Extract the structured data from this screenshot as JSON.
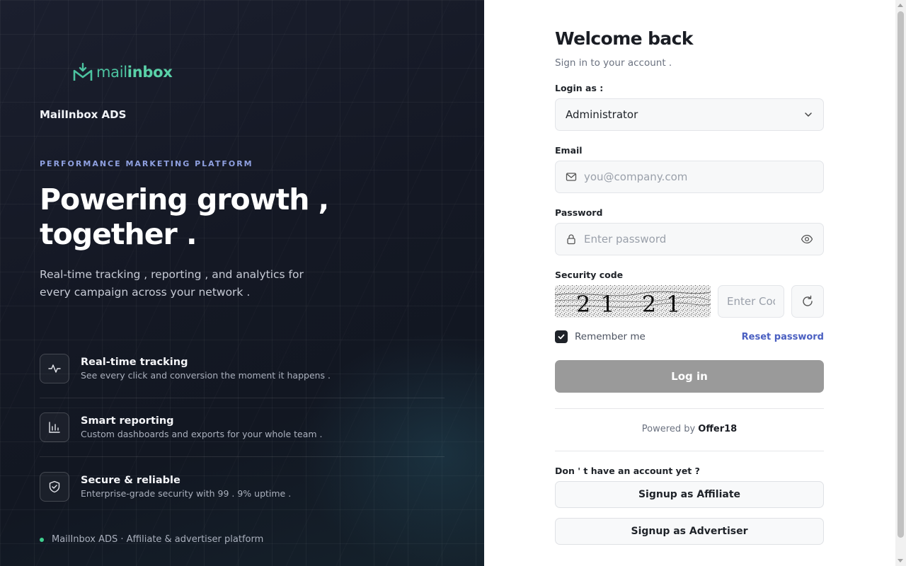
{
  "left": {
    "logo_part1": "mail",
    "logo_part2": "inbox",
    "brand": "MailInbox ADS",
    "eyebrow": "PERFORMANCE MARKETING PLATFORM",
    "headline_line1": "Powering growth ,",
    "headline_line2": "together .",
    "subtitle": "Real-time tracking , reporting , and analytics for every campaign across your network .",
    "features": [
      {
        "icon": "activity-icon",
        "title": "Real-time tracking",
        "desc": "See every click and conversion the moment it happens ."
      },
      {
        "icon": "bar-chart-icon",
        "title": "Smart reporting",
        "desc": "Custom dashboards and exports for your whole team ."
      },
      {
        "icon": "shield-check-icon",
        "title": "Secure & reliable",
        "desc": "Enterprise-grade security with 99 . 9% uptime ."
      }
    ],
    "footer": "MailInbox ADS · Affiliate & advertiser platform"
  },
  "form": {
    "title": "Welcome back",
    "subtitle": "Sign in to your account .",
    "login_as_label": "Login as :",
    "login_as_value": "Administrator",
    "email_label": "Email",
    "email_placeholder": "you@company.com",
    "password_label": "Password",
    "password_placeholder": "Enter password",
    "security_label": "Security code",
    "captcha_text": "21 21",
    "captcha_placeholder": "Enter Code",
    "remember_label": "Remember me",
    "remember_checked": true,
    "reset_label": "Reset password",
    "login_label": "Log in",
    "powered_prefix": "Powered by",
    "powered_brand": "Offer18",
    "no_account": "Don ' t have an account yet ?",
    "signup_affiliate": "Signup as Affiliate",
    "signup_advertiser": "Signup as Advertiser"
  },
  "colors": {
    "accent": "#4a5fc1",
    "logo_green": "#4cc3a0",
    "eyebrow": "#8fa0e0",
    "status_dot": "#3ecf8e",
    "login_button": "#9a9a9a"
  }
}
